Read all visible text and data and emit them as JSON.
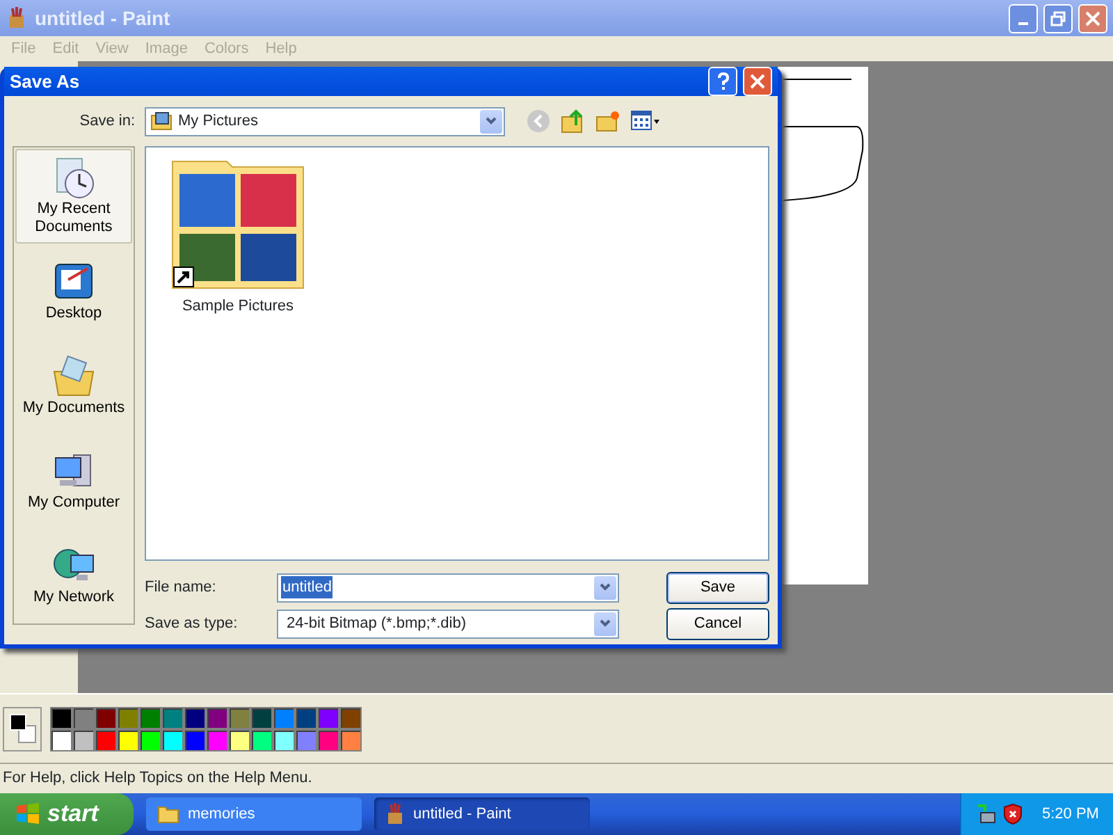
{
  "paint_window": {
    "title": "untitled - Paint",
    "menu": [
      {
        "label": "File",
        "disabled": true
      },
      {
        "label": "Edit",
        "disabled": true
      },
      {
        "label": "View",
        "disabled": true
      },
      {
        "label": "Image",
        "disabled": true
      },
      {
        "label": "Colors",
        "disabled": true
      },
      {
        "label": "Help",
        "disabled": true
      }
    ],
    "palette": {
      "rows": [
        [
          {
            "color": "#000000"
          },
          {
            "color": "#808080"
          },
          {
            "color": "#800000"
          },
          {
            "color": "#808000"
          },
          {
            "color": "#008000"
          },
          {
            "color": "#008080"
          },
          {
            "color": "#000080"
          },
          {
            "color": "#800080"
          },
          {
            "color": "#808040"
          },
          {
            "color": "#004040"
          },
          {
            "color": "#0080ff"
          },
          {
            "color": "#004080"
          },
          {
            "color": "#8000ff"
          },
          {
            "color": "#804000"
          }
        ],
        [
          {
            "color": "#ffffff"
          },
          {
            "color": "#c0c0c0"
          },
          {
            "color": "#ff0000"
          },
          {
            "color": "#ffff00"
          },
          {
            "color": "#00ff00"
          },
          {
            "color": "#00ffff"
          },
          {
            "color": "#0000ff"
          },
          {
            "color": "#ff00ff"
          },
          {
            "color": "#ffff80"
          },
          {
            "color": "#00ff80"
          },
          {
            "color": "#80ffff"
          },
          {
            "color": "#8080ff"
          },
          {
            "color": "#ff0080"
          },
          {
            "color": "#ff8040"
          }
        ]
      ]
    },
    "status_bar": "For Help, click Help Topics on the Help Menu."
  },
  "dialog": {
    "title": "Save As",
    "save_in_label": "Save in:",
    "save_in_value": "My Pictures",
    "places": [
      {
        "kind": "recent",
        "label": "My Recent Documents",
        "selected": true
      },
      {
        "kind": "desktop",
        "label": "Desktop",
        "selected": false
      },
      {
        "kind": "documents",
        "label": "My Documents",
        "selected": false
      },
      {
        "kind": "computer",
        "label": "My Computer",
        "selected": false
      },
      {
        "kind": "network",
        "label": "My Network",
        "selected": false
      }
    ],
    "files": [
      {
        "label": "Sample Pictures"
      }
    ],
    "file_name_label": "File name:",
    "file_name_value": "untitled",
    "save_as_type_label": "Save as type:",
    "save_as_type_value": "24-bit Bitmap (*.bmp;*.dib)",
    "buttons": [
      {
        "label": "Save",
        "default": true
      },
      {
        "label": "Cancel",
        "default": false
      }
    ]
  },
  "taskbar": {
    "start": "start",
    "tasks": [
      {
        "label": "memories",
        "kind": "folder",
        "selected": false
      },
      {
        "label": "untitled - Paint",
        "kind": "paint",
        "selected": true
      }
    ],
    "clock": "5:20 PM"
  }
}
